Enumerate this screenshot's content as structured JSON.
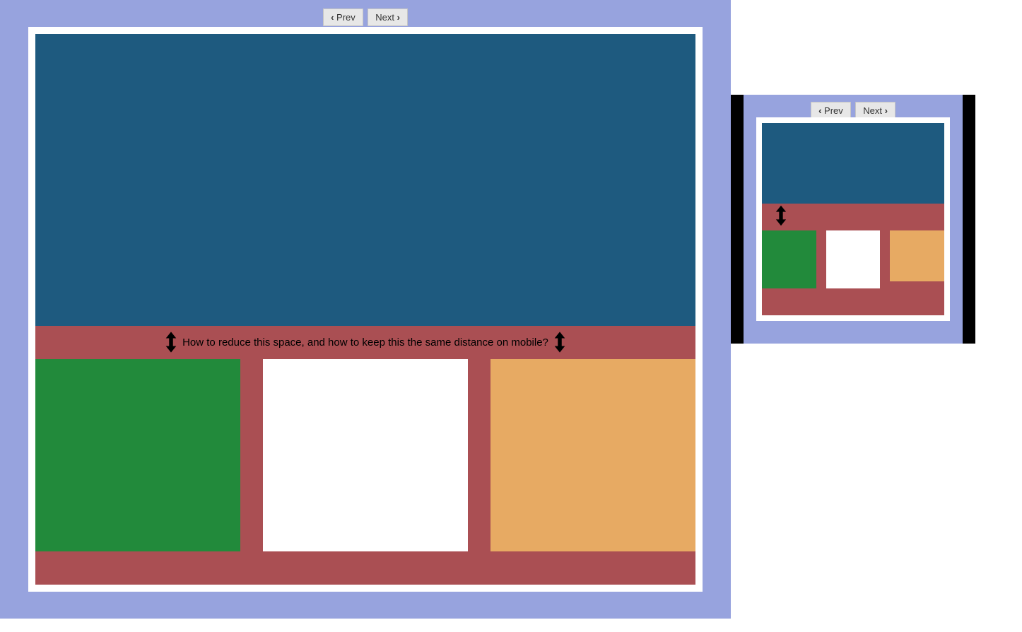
{
  "nav": {
    "prev_label": "Prev",
    "next_label": "Next"
  },
  "annotation": {
    "main_question": "How to reduce this space, and how to keep this the same distance on mobile?"
  },
  "colors": {
    "frame": "#97a3de",
    "card_bg": "#ffffff",
    "section_bg": "#aa4f53",
    "hero": "#1e5a7f",
    "tile_green": "#228a3b",
    "tile_white": "#ffffff",
    "tile_orange": "#e7aa63",
    "mobile_bezel": "#000000"
  }
}
